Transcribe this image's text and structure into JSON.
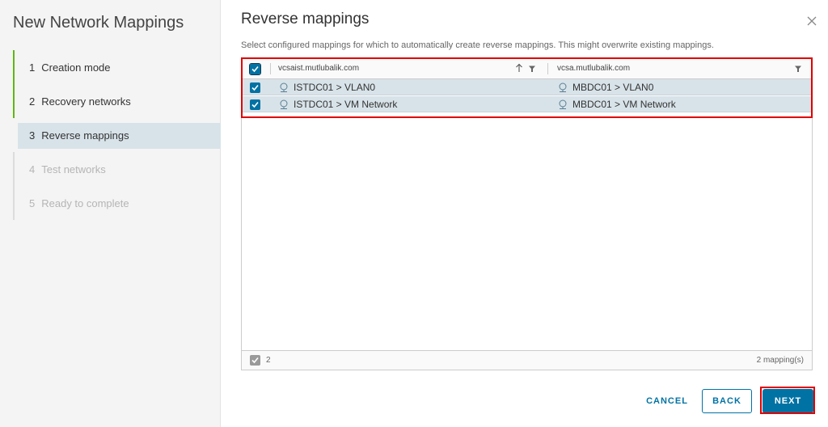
{
  "wizard": {
    "title": "New Network Mappings",
    "steps": [
      {
        "num": "1",
        "label": "Creation mode",
        "state": "done"
      },
      {
        "num": "2",
        "label": "Recovery networks",
        "state": "done"
      },
      {
        "num": "3",
        "label": "Reverse mappings",
        "state": "current"
      },
      {
        "num": "4",
        "label": "Test networks",
        "state": "pending"
      },
      {
        "num": "5",
        "label": "Ready to complete",
        "state": "pending"
      }
    ]
  },
  "page": {
    "heading": "Reverse mappings",
    "description": "Select configured mappings for which to automatically create reverse mappings. This might overwrite existing mappings.",
    "close_icon": "close-icon"
  },
  "grid": {
    "columns": [
      "vcsaist.mutlubalik.com",
      "vcsa.mutlubalik.com"
    ],
    "rows": [
      {
        "source": "ISTDC01 > VLAN0",
        "target": "MBDC01 > VLAN0",
        "checked": true
      },
      {
        "source": "ISTDC01 > VM Network",
        "target": "MBDC01 > VM Network",
        "checked": true
      }
    ],
    "footer": {
      "selected_count": "2",
      "total": "2 mapping(s)"
    }
  },
  "buttons": {
    "cancel": "CANCEL",
    "back": "BACK",
    "next": "NEXT"
  },
  "colors": {
    "accent": "#0072a3",
    "done_step": "#60b515",
    "highlight": "#e00000",
    "selected_row": "#d8e3e9"
  }
}
